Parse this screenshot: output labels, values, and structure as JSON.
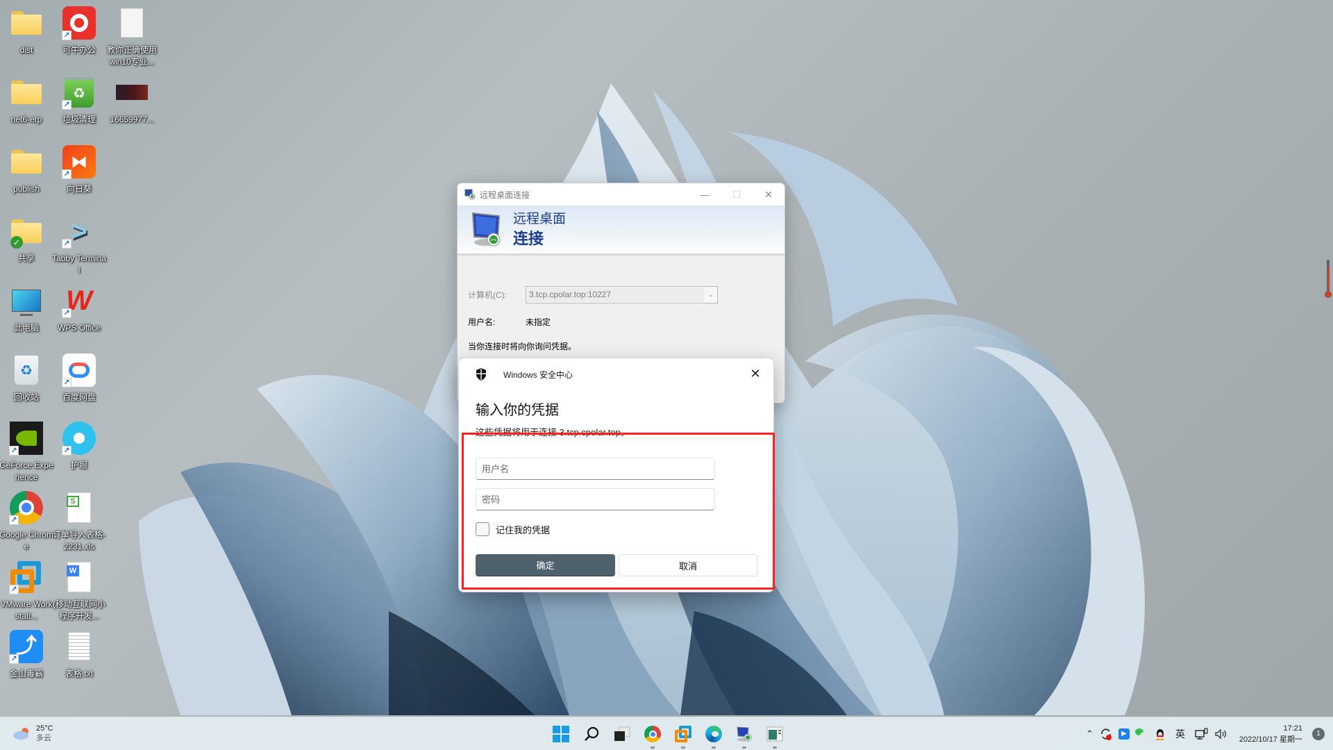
{
  "desktop": {
    "icons": [
      {
        "label": "dist",
        "type": "folder"
      },
      {
        "label": "可牛办公",
        "type": "shortcut"
      },
      {
        "label": "教你正确使用win10专业...",
        "type": "file"
      },
      {
        "label": "net6-erp",
        "type": "folder"
      },
      {
        "label": "垃圾清理",
        "type": "shortcut"
      },
      {
        "label": "16659977...",
        "type": "image"
      },
      {
        "label": "publish",
        "type": "folder"
      },
      {
        "label": "向日葵",
        "type": "shortcut"
      },
      {
        "label": "共享",
        "type": "folder"
      },
      {
        "label": "Tabby Terminal",
        "type": "shortcut"
      },
      {
        "label": "此电脑",
        "type": "system"
      },
      {
        "label": "WPS Office",
        "type": "shortcut"
      },
      {
        "label": "回收站",
        "type": "system"
      },
      {
        "label": "百度网盘",
        "type": "shortcut"
      },
      {
        "label": "GeForce Experience",
        "type": "shortcut"
      },
      {
        "label": "护眼",
        "type": "shortcut"
      },
      {
        "label": "Google Chrome",
        "type": "shortcut"
      },
      {
        "label": "订单导入表格-2231.xls",
        "type": "file"
      },
      {
        "label": "VMware Workstati...",
        "type": "shortcut"
      },
      {
        "label": "(移动互联网小程序开发...",
        "type": "file"
      },
      {
        "label": "金山毒霸",
        "type": "shortcut"
      },
      {
        "label": "表格.txt",
        "type": "file"
      }
    ]
  },
  "rdp_window": {
    "title": "远程桌面连接",
    "banner_line1": "远程桌面",
    "banner_line2": "连接",
    "computer_label": "计算机(C):",
    "computer_value": "3.tcp.cpolar.top:10227",
    "username_label": "用户名:",
    "username_value": "未指定",
    "info_text": "当你连接时将向你询问凭据。",
    "minimize_icon": "—",
    "maximize_icon": "☐",
    "close_icon": "✕"
  },
  "security_dialog": {
    "app_name": "Windows 安全中心",
    "title": "输入你的凭据",
    "description": "这些凭据将用于连接 3.tcp.cpolar.top。",
    "username_placeholder": "用户名",
    "password_placeholder": "密码",
    "remember_label": "记住我的凭据",
    "remember_checked": false,
    "ok_label": "确定",
    "cancel_label": "取消",
    "close_icon": "✕"
  },
  "annotation": {
    "color": "#ff1f1f"
  },
  "taskbar": {
    "weather_temp": "25°C",
    "weather_cond": "多云",
    "apps": [
      {
        "name": "start",
        "running": false
      },
      {
        "name": "search",
        "running": false
      },
      {
        "name": "task-view",
        "running": false
      },
      {
        "name": "chrome",
        "running": true
      },
      {
        "name": "vmware",
        "running": true
      },
      {
        "name": "edge",
        "running": true
      },
      {
        "name": "remote-desktop",
        "running": true
      },
      {
        "name": "app-window",
        "running": true
      }
    ],
    "tray": {
      "chevron": "^",
      "ime": "英"
    },
    "time": "17:21",
    "date": "2022/10/17 星期一",
    "notification_count": "1"
  }
}
